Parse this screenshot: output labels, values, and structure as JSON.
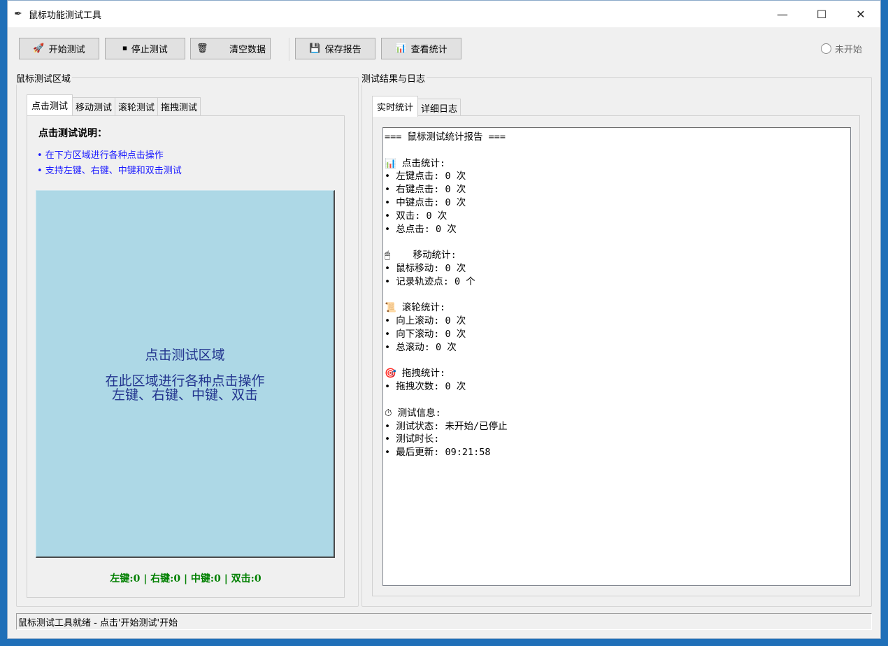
{
  "window": {
    "title": "鼠标功能测试工具",
    "title_icon": "feather-icon",
    "minimize_glyph": "—",
    "maximize_glyph": "☐",
    "close_glyph": "✕"
  },
  "toolbar": {
    "start": {
      "icon": "🚀",
      "label": "开始测试"
    },
    "stop": {
      "icon": "⏹",
      "label": "停止测试"
    },
    "clear": {
      "icon": "🗑",
      "label": "清空数据"
    },
    "save": {
      "icon": "💾",
      "label": "保存报告"
    },
    "stats": {
      "icon": "📊",
      "label": "查看统计"
    },
    "status_label": "未开始"
  },
  "left_group": {
    "title": "鼠标测试区域",
    "tabs": [
      "点击测试",
      "移动测试",
      "滚轮测试",
      "拖拽测试"
    ],
    "active_tab": 0,
    "desc_title": "点击测试说明：",
    "desc_lines": [
      "• 在下方区域进行各种点击操作",
      "• 支持左键、右键、中键和双击测试"
    ],
    "click_area": {
      "title": "点击测试区域",
      "line1": "在此区域进行各种点击操作",
      "line2": "左键、右键、中键、双击"
    },
    "counters": "左键:0  |  右键:0  |  中键:0  |  双击:0"
  },
  "right_group": {
    "title": "测试结果与日志",
    "tabs": [
      "实时统计",
      "详细日志"
    ],
    "active_tab": 0,
    "log_lines": [
      "=== 鼠标测试统计报告 ===",
      "",
      "📊 点击统计:",
      "• 左键点击: 0 次",
      "• 右键点击: 0 次",
      "• 中键点击: 0 次",
      "• 双击: 0 次",
      "• 总点击: 0 次",
      "",
      "🖱    移动统计:",
      "• 鼠标移动: 0 次",
      "• 记录轨迹点: 0 个",
      "",
      "📜 滚轮统计:",
      "• 向上滚动: 0 次",
      "• 向下滚动: 0 次",
      "• 总滚动: 0 次",
      "",
      "🎯 拖拽统计:",
      "• 拖拽次数: 0 次",
      "",
      "⏱ 测试信息:",
      "• 测试状态: 未开始/已停止",
      "• 测试时长:",
      "• 最后更新: 09:21:58"
    ]
  },
  "statusbar": {
    "text": "鼠标测试工具就绪 - 点击'开始测试'开始"
  }
}
